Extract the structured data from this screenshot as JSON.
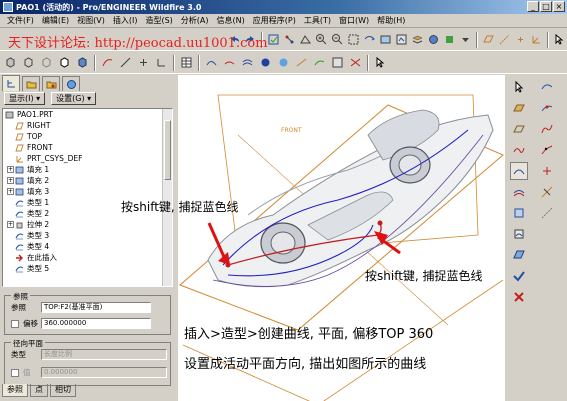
{
  "window": {
    "title": "PAO1 (活动的) - Pro/ENGINEER Wildfire 3.0"
  },
  "menu": [
    "文件(F)",
    "编辑(E)",
    "视图(V)",
    "插入(I)",
    "造型(S)",
    "分析(A)",
    "信息(N)",
    "应用程序(P)",
    "工具(T)",
    "窗口(W)",
    "帮助(H)"
  ],
  "watermark": "天下设计论坛: http://peocad.uu1001.com",
  "panel": {
    "show_label": "显示(I) ▾",
    "settings_label": "设置(G) ▾",
    "tree": [
      {
        "label": "PAO1.PRT",
        "icon": "part-icon",
        "level": 0,
        "expand": false
      },
      {
        "label": "RIGHT",
        "icon": "datum-plane-icon",
        "level": 1,
        "expand": false
      },
      {
        "label": "TOP",
        "icon": "datum-plane-icon",
        "level": 1,
        "expand": false
      },
      {
        "label": "FRONT",
        "icon": "datum-plane-icon",
        "level": 1,
        "expand": false
      },
      {
        "label": "PRT_CSYS_DEF",
        "icon": "csys-icon",
        "level": 1,
        "expand": false
      },
      {
        "label": "填充 1",
        "icon": "fill-icon",
        "level": 1,
        "expand": true
      },
      {
        "label": "填充 2",
        "icon": "fill-icon",
        "level": 1,
        "expand": true
      },
      {
        "label": "填充 3",
        "icon": "fill-icon",
        "level": 1,
        "expand": true
      },
      {
        "label": "类型 1",
        "icon": "style-icon",
        "level": 1,
        "expand": false
      },
      {
        "label": "类型 2",
        "icon": "style-icon",
        "level": 1,
        "expand": false
      },
      {
        "label": "拉伸 2",
        "icon": "extrude-icon",
        "level": 1,
        "expand": true
      },
      {
        "label": "类型 3",
        "icon": "style-icon",
        "level": 1,
        "expand": false
      },
      {
        "label": "类型 4",
        "icon": "style-icon",
        "level": 1,
        "expand": false
      },
      {
        "label": "在此插入",
        "icon": "insert-here-icon",
        "level": 1,
        "expand": false
      },
      {
        "label": "类型 5",
        "icon": "style-icon",
        "level": 1,
        "expand": false
      }
    ]
  },
  "dashboard": {
    "ref_group": "参照",
    "ref_label": "参照",
    "ref_value": "TOP:F2(基准平面)",
    "offset_label": "偏移",
    "offset_value": "360.000000",
    "radial_group": "径向平面",
    "type_label": "类型",
    "type_value": "长度比例",
    "value_label": "值",
    "value_value": "0.000000",
    "tabs": [
      "参照",
      "点",
      "相切"
    ]
  },
  "canvas": {
    "plane_label": "FRONT",
    "annotation_1": "按shift键, 捕捉蓝色线",
    "annotation_2": "按shift键, 捕捉蓝色线",
    "instruction_1": "插入>造型>创建曲线, 平面, 偏移TOP 360",
    "instruction_2": "设置成活动平面方向, 描出如图所示的曲线"
  },
  "colors": {
    "annotation_arrow": "#e01010",
    "curve_blue": "#2020c0",
    "datum_orange": "#d08a30",
    "watermark": "#e82020"
  }
}
